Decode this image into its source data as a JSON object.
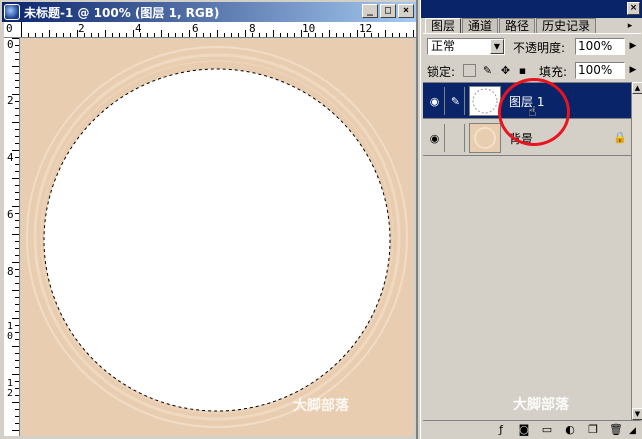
{
  "document": {
    "title": "未标题-1 @ 100% (图层 1, RGB)",
    "buttons": {
      "minimize": "_",
      "maximize": "□",
      "close": "×"
    },
    "ruler_top_labels": [
      "0",
      "2",
      "4",
      "6",
      "8",
      "10",
      "12"
    ],
    "ruler_left_labels": [
      "0",
      "2",
      "4",
      "6",
      "8",
      "10",
      "12"
    ],
    "canvas_color": "#e8cdb0",
    "watermark": "大脚部落"
  },
  "panel": {
    "tabs": [
      {
        "label": "图层",
        "active": true
      },
      {
        "label": "通道",
        "active": false
      },
      {
        "label": "路径",
        "active": false
      },
      {
        "label": "历史记录",
        "active": false
      }
    ],
    "menu_icon": "▸",
    "blend_mode": "正常",
    "opacity_label": "不透明度:",
    "opacity_value": "100%",
    "lock_label": "锁定:",
    "fill_label": "填充:",
    "fill_value": "100%",
    "layers": [
      {
        "name": "图层 1",
        "selected": true
      },
      {
        "name": "背景",
        "selected": false
      }
    ],
    "watermark": "大脚部落",
    "accent_color": "#0a246a",
    "highlight_color": "#e8141e"
  }
}
